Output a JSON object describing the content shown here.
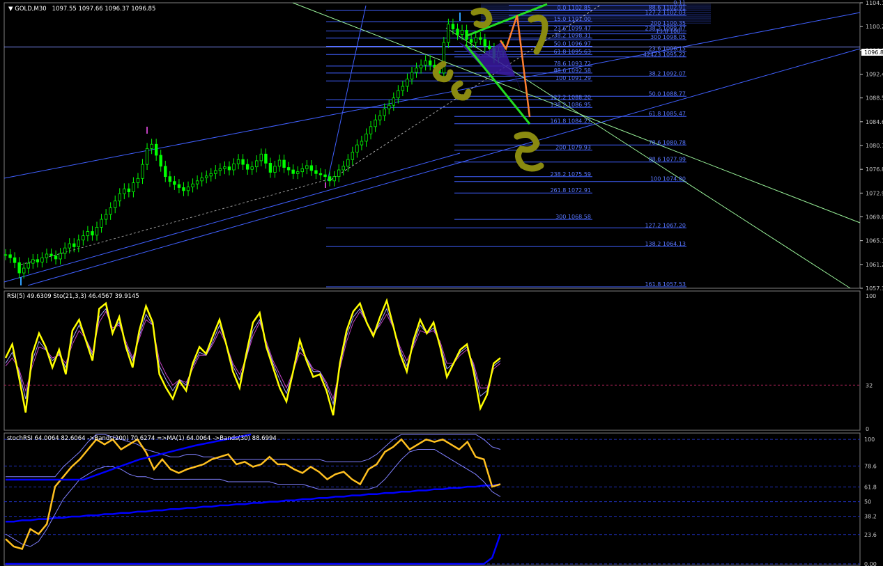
{
  "main": {
    "title": "GOLD,M30",
    "ohlc": "1097.55 1097.66 1096.37 1096.85",
    "current_price_label": "1096.85",
    "y_axis_ticks": [
      "1104.1",
      "1100.2",
      "1096.3",
      "1092.4",
      "1088.5",
      "1084.6",
      "1080.7",
      "1076.8",
      "1072.9",
      "1069.0",
      "1065.1",
      "1061.2",
      "1057.3"
    ]
  },
  "fib_upper": [
    {
      "text": "0.0 1102.85"
    },
    {
      "text": "15.0 1101.00"
    },
    {
      "text": "23.6 1099.47"
    },
    {
      "text": "38.2 1098.31"
    },
    {
      "text": "50.0 1096.97"
    },
    {
      "text": "61.8 1095.63"
    },
    {
      "text": "78.6 1093.72"
    },
    {
      "text": "88.6 1092.58"
    },
    {
      "text": "100 1091.29"
    },
    {
      "text": "127.2 1088.20"
    },
    {
      "text": "138.2 1086.95"
    },
    {
      "text": "161.8 1084.27"
    },
    {
      "text": "200 1079.93"
    },
    {
      "text": "238.2 1075.59"
    },
    {
      "text": "261.8 1072.91"
    },
    {
      "text": "300 1068.58"
    }
  ],
  "fib_right": [
    {
      "text": "0.11"
    },
    {
      "text": "88.6 1102.91"
    },
    {
      "text": "127.2 1102.03"
    },
    {
      "text": "200 1100.35"
    },
    {
      "text": "238.2 1099.47"
    },
    {
      "text": "13.8 100..."
    },
    {
      "text": "300 1098.05"
    },
    {
      "text": "23.6 1096.15"
    },
    {
      "text": "42423 1095.22"
    },
    {
      "text": "38.2 1092.07"
    },
    {
      "text": "50.0 1088.77"
    },
    {
      "text": "61.8 1085.47"
    },
    {
      "text": "78.6 1080.78"
    },
    {
      "text": "88.6 1077.99"
    },
    {
      "text": "100 1074.80"
    },
    {
      "text": "127.2 1067.20"
    },
    {
      "text": "138.2 1064.13"
    },
    {
      "text": "161.8 1057.53"
    }
  ],
  "rsi_panel": {
    "header": "RSI(5) 49.6309  Sto(21,3,3) 46.4567 39.9145",
    "ticks": [
      "100",
      "32",
      "0"
    ]
  },
  "stoch_panel": {
    "header": "stochRSI 64.0064 82.6064  ->Bands(200) 70.6274  =>MA(1) 64.0064  ->Bands(30) 88.6994",
    "ticks": [
      "100",
      "78.6",
      "61.8",
      "50",
      "38.2",
      "23.6",
      "0.00"
    ]
  },
  "colors": {
    "background": "#000000",
    "candle": "#00ff00",
    "fib": "#4060ff",
    "rsi": "#ffff00",
    "stoch": "#ffc020",
    "bands": "#0000ff",
    "green_arrow": "#22dd22",
    "orange_arrow": "#ff8030",
    "channel": "#98f098",
    "drawing": "#8a8a10"
  },
  "chart_data": [
    {
      "type": "candlestick",
      "title": "GOLD,M30",
      "ylim": [
        1057.3,
        1104.1
      ],
      "last_close": 1096.85,
      "series": [
        {
          "values": [
            1062.8,
            1062.3,
            1061.5,
            1059.8,
            1060.6,
            1061.4,
            1062.0,
            1061.6,
            1062.3,
            1062.9,
            1062.6,
            1062.1,
            1063.0,
            1063.9,
            1064.6,
            1064.1,
            1065.2,
            1065.9,
            1066.6,
            1066.0,
            1067.3,
            1068.6,
            1069.4,
            1070.5,
            1071.6,
            1072.8,
            1073.6,
            1073.1,
            1074.6,
            1075.3,
            1077.6,
            1080.2,
            1080.9,
            1079.1,
            1077.3,
            1075.6,
            1074.8,
            1074.3,
            1073.8,
            1073.3,
            1073.9,
            1074.4,
            1074.9,
            1075.4,
            1075.7,
            1076.1,
            1076.6,
            1076.9,
            1077.2,
            1076.7,
            1077.7,
            1078.4,
            1077.6,
            1076.8,
            1077.2,
            1078.2,
            1079.3,
            1077.8,
            1076.3,
            1077.3,
            1078.3,
            1077.1,
            1076.7,
            1076.1,
            1076.4,
            1076.9,
            1077.4,
            1076.6,
            1076.1,
            1075.9,
            1075.6,
            1074.9,
            1075.6,
            1076.7,
            1077.3,
            1078.4,
            1079.6,
            1080.8,
            1081.4,
            1082.6,
            1083.8,
            1084.9,
            1085.6,
            1086.7,
            1087.3,
            1088.5,
            1089.7,
            1090.4,
            1091.6,
            1092.7,
            1093.4,
            1093.9,
            1094.6,
            1093.9,
            1093.4,
            1092.6,
            1097.6,
            1100.6,
            1099.8,
            1098.9,
            1099.6,
            1098.1,
            1097.6,
            1098.4,
            1098.1,
            1097.0,
            1096.6,
            1095.1,
            1096.1,
            1096.85
          ]
        }
      ]
    },
    {
      "type": "line",
      "title": "RSI(5) 49.6309  Sto(21,3,3) 46.4567 39.9145",
      "ylim": [
        0,
        100
      ],
      "series": [
        {
          "name": "RSI(5)",
          "values": [
            52,
            62,
            38,
            12,
            55,
            70,
            60,
            45,
            58,
            40,
            72,
            80,
            65,
            50,
            88,
            92,
            70,
            82,
            60,
            45,
            72,
            90,
            78,
            40,
            30,
            22,
            35,
            28,
            48,
            60,
            55,
            68,
            80,
            62,
            42,
            30,
            55,
            78,
            85,
            60,
            45,
            30,
            20,
            42,
            65,
            50,
            38,
            40,
            28,
            10,
            48,
            72,
            86,
            92,
            78,
            68,
            82,
            94,
            75,
            55,
            42,
            65,
            80,
            70,
            78,
            60,
            38,
            48,
            58,
            62,
            42,
            15,
            25,
            48,
            52
          ]
        },
        {
          "name": "Sto(21,3,3) %K",
          "values": [
            48,
            56,
            42,
            22,
            50,
            64,
            58,
            50,
            55,
            45,
            66,
            76,
            66,
            54,
            82,
            88,
            72,
            78,
            62,
            50,
            68,
            84,
            76,
            46,
            36,
            28,
            36,
            32,
            46,
            56,
            54,
            64,
            76,
            62,
            46,
            36,
            52,
            72,
            80,
            62,
            48,
            36,
            26,
            42,
            60,
            52,
            42,
            42,
            32,
            18,
            46,
            68,
            82,
            88,
            78,
            68,
            78,
            88,
            74,
            58,
            46,
            62,
            76,
            70,
            74,
            62,
            44,
            48,
            56,
            60,
            46,
            24,
            28,
            46,
            50
          ]
        },
        {
          "name": "Sto(21,3,3) %D",
          "values": [
            46,
            52,
            44,
            28,
            46,
            60,
            58,
            52,
            54,
            48,
            62,
            72,
            66,
            56,
            78,
            86,
            74,
            76,
            64,
            52,
            66,
            80,
            76,
            50,
            40,
            32,
            36,
            34,
            44,
            54,
            54,
            62,
            72,
            62,
            48,
            40,
            52,
            68,
            78,
            64,
            50,
            40,
            30,
            42,
            56,
            52,
            44,
            42,
            34,
            22,
            44,
            64,
            78,
            86,
            78,
            70,
            76,
            84,
            74,
            60,
            50,
            60,
            72,
            70,
            72,
            64,
            48,
            48,
            54,
            58,
            48,
            30,
            30,
            44,
            48
          ]
        }
      ]
    },
    {
      "type": "line",
      "title": "stochRSI 64.0064 82.6064  ->Bands(200) 70.6274  =>MA(1) 64.0064  ->Bands(30) 88.6994",
      "ylim": [
        0,
        100
      ],
      "series": [
        {
          "name": "stochRSI",
          "values": [
            20,
            14,
            12,
            28,
            24,
            32,
            62,
            70,
            78,
            84,
            92,
            100,
            96,
            100,
            92,
            96,
            100,
            90,
            76,
            84,
            76,
            73,
            76,
            78,
            80,
            84,
            86,
            88,
            80,
            82,
            78,
            80,
            86,
            80,
            80,
            76,
            73,
            78,
            74,
            68,
            72,
            74,
            68,
            64,
            76,
            80,
            90,
            94,
            100,
            92,
            96,
            100,
            98,
            100,
            96,
            92,
            98,
            86,
            84,
            62,
            64
          ]
        },
        {
          "name": "Bands(200) mid",
          "values": [
            34,
            34,
            35,
            35,
            36,
            36,
            37,
            37,
            38,
            38,
            39,
            39,
            40,
            40,
            41,
            41,
            42,
            42,
            43,
            43,
            44,
            44,
            45,
            45,
            46,
            46,
            47,
            47,
            48,
            48,
            49,
            49,
            50,
            50,
            51,
            51,
            52,
            52,
            53,
            53,
            54,
            54,
            55,
            55,
            56,
            56,
            57,
            57,
            58,
            58,
            59,
            59,
            60,
            60,
            61,
            61,
            62,
            62,
            63,
            63,
            64
          ]
        },
        {
          "name": "Bands(200) low",
          "values": [
            0,
            0,
            0,
            0,
            0,
            0,
            0,
            0,
            0,
            0,
            0,
            0,
            0,
            0,
            0,
            0,
            0,
            0,
            0,
            0,
            0,
            0,
            0,
            0,
            0,
            0,
            0,
            0,
            0,
            0,
            0,
            0,
            0,
            0,
            0,
            0,
            0,
            0,
            0,
            0,
            0,
            0,
            0,
            0,
            0,
            0,
            0,
            0,
            0,
            0,
            0,
            0,
            0,
            0,
            0,
            0,
            0,
            0,
            0,
            5,
            24
          ]
        },
        {
          "name": "Bands(30) upper",
          "values": [
            70,
            70,
            70,
            70,
            70,
            70,
            70,
            78,
            84,
            90,
            98,
            104,
            104,
            102,
            100,
            98,
            96,
            92,
            90,
            88,
            86,
            86,
            88,
            88,
            86,
            86,
            84,
            84,
            84,
            84,
            84,
            84,
            84,
            84,
            84,
            84,
            84,
            84,
            84,
            82,
            82,
            82,
            82,
            82,
            84,
            88,
            94,
            100,
            104,
            104,
            104,
            104,
            104,
            104,
            104,
            104,
            104,
            104,
            100,
            94,
            92
          ]
        },
        {
          "name": "Bands(30) lower",
          "values": [
            24,
            20,
            16,
            14,
            18,
            28,
            40,
            52,
            60,
            68,
            72,
            76,
            78,
            78,
            76,
            72,
            70,
            70,
            68,
            68,
            68,
            68,
            68,
            68,
            68,
            68,
            68,
            66,
            66,
            66,
            66,
            66,
            66,
            64,
            64,
            64,
            64,
            62,
            60,
            60,
            60,
            60,
            60,
            60,
            60,
            62,
            68,
            76,
            84,
            90,
            92,
            92,
            92,
            88,
            84,
            80,
            76,
            72,
            66,
            58,
            54
          ]
        }
      ]
    }
  ]
}
